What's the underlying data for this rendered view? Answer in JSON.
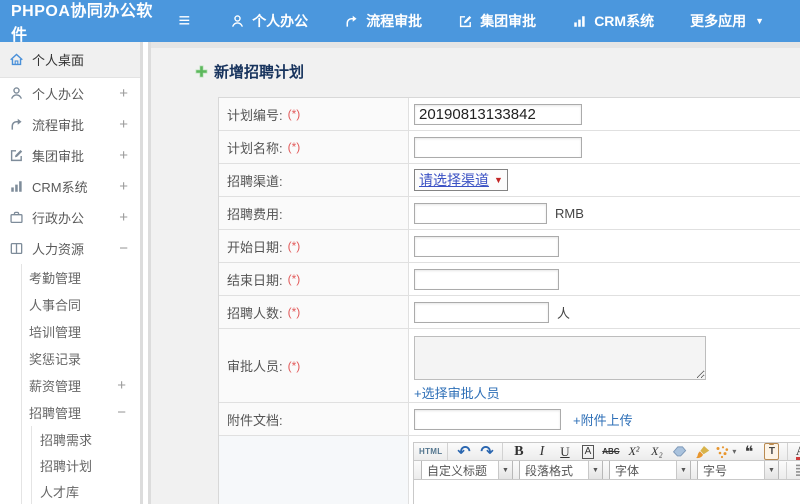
{
  "glyphs": {
    "menu": "≡",
    "caret_down": "▼",
    "small_caret": "▾",
    "undo": "↶",
    "redo": "↷",
    "quote": "❝",
    "pencil": "✎"
  },
  "colors": {
    "topbar_blue": "#4b97dd",
    "green_plus": "#5cb85c",
    "link_blue": "#2e6fb7",
    "required_red": "#e25b5b",
    "active_icon_blue": "#4a90d9"
  },
  "topbar": {
    "logo": "PHPOA协同办公软件",
    "items": [
      {
        "label": "个人办公"
      },
      {
        "label": "流程审批"
      },
      {
        "label": "集团审批"
      },
      {
        "label": "CRM系统"
      },
      {
        "label": "更多应用"
      }
    ]
  },
  "sidebar": {
    "items": [
      {
        "label": "个人桌面"
      },
      {
        "label": "个人办公",
        "expander": "+"
      },
      {
        "label": "流程审批",
        "expander": "+"
      },
      {
        "label": "集团审批",
        "expander": "+"
      },
      {
        "label": "CRM系统",
        "expander": "+"
      },
      {
        "label": "行政办公",
        "expander": "+"
      },
      {
        "label": "人力资源",
        "expander": "−"
      }
    ],
    "hr_items": [
      {
        "label": "考勤管理"
      },
      {
        "label": "人事合同"
      },
      {
        "label": "培训管理"
      },
      {
        "label": "奖惩记录"
      },
      {
        "label": "薪资管理",
        "expander": "+"
      },
      {
        "label": "招聘管理",
        "expander": "−"
      }
    ],
    "recruit_items": [
      {
        "label": "招聘需求"
      },
      {
        "label": "招聘计划"
      },
      {
        "label": "人才库"
      }
    ]
  },
  "page": {
    "title": "新增招聘计划"
  },
  "form": {
    "plan_no": {
      "label": "计划编号:",
      "required": "(*)",
      "value": "20190813133842"
    },
    "plan_name": {
      "label": "计划名称:",
      "required": "(*)"
    },
    "channel": {
      "label": "招聘渠道:",
      "selected": "请选择渠道"
    },
    "cost": {
      "label": "招聘费用:",
      "suffix": "RMB"
    },
    "start_date": {
      "label": "开始日期:",
      "required": "(*)"
    },
    "end_date": {
      "label": "结束日期:",
      "required": "(*)"
    },
    "headcount": {
      "label": "招聘人数:",
      "required": "(*)",
      "suffix": "人"
    },
    "approvers": {
      "label": "审批人员:",
      "required": "(*)",
      "link": "+选择审批人员"
    },
    "attachment": {
      "label": "附件文档:",
      "link": "+附件上传"
    }
  },
  "editor": {
    "toolbar1": {
      "html": "HTML",
      "bold": "B",
      "italic": "I",
      "underline": "U",
      "boxed_a": "A",
      "strike": "ABC",
      "sup": "X²",
      "sub": "X₂",
      "paste_text": "T",
      "font_color": "A",
      "highlight": "ab"
    },
    "toolbar2": {
      "heading": "自定义标题",
      "paragraph": "段落格式",
      "font": "字体",
      "size": "字号"
    }
  }
}
